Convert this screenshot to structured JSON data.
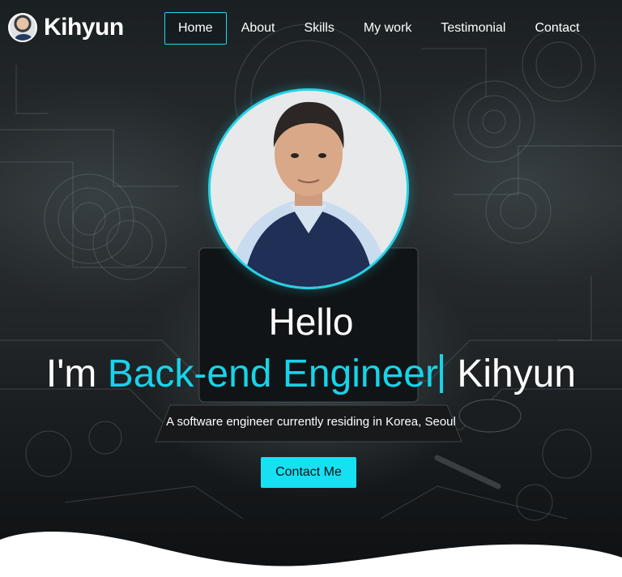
{
  "brand": {
    "name": "Kihyun",
    "avatar_icon": "profile-avatar"
  },
  "nav": {
    "items": [
      {
        "label": "Home",
        "active": true
      },
      {
        "label": "About",
        "active": false
      },
      {
        "label": "Skills",
        "active": false
      },
      {
        "label": "My work",
        "active": false
      },
      {
        "label": "Testimonial",
        "active": false
      },
      {
        "label": "Contact",
        "active": false
      }
    ]
  },
  "hero": {
    "greeting": "Hello",
    "intro_prefix": "I'm ",
    "role": "Back-end Engineer",
    "name": " Kihyun",
    "subtitle": "A software engineer currently residing in Korea, Seoul",
    "cta_label": "Contact Me"
  },
  "colors": {
    "accent": "#16d4ea",
    "cta_background": "#16e0f2",
    "text": "#ffffff",
    "wave": "#ffffff"
  }
}
